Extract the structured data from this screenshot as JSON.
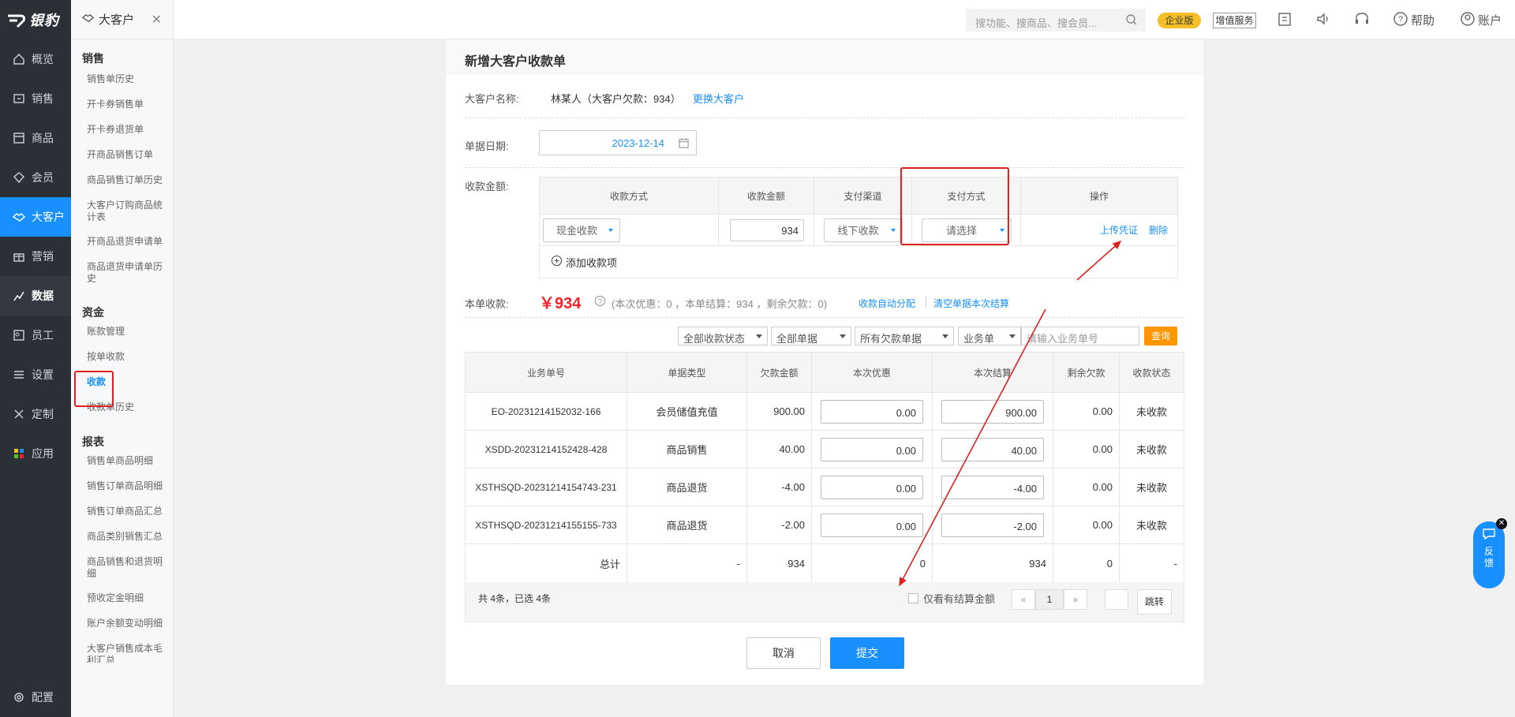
{
  "brand": {
    "name": "银豹"
  },
  "nav": {
    "items": [
      {
        "label": "概览",
        "icon": "home-icon"
      },
      {
        "label": "销售",
        "icon": "sales-icon"
      },
      {
        "label": "商品",
        "icon": "goods-icon"
      },
      {
        "label": "会员",
        "icon": "member-icon"
      },
      {
        "label": "大客户",
        "icon": "handshake-icon"
      },
      {
        "label": "营销",
        "icon": "marketing-icon"
      },
      {
        "label": "数据",
        "icon": "chart-icon"
      },
      {
        "label": "员工",
        "icon": "staff-icon"
      },
      {
        "label": "设置",
        "icon": "settings-icon"
      },
      {
        "label": "定制",
        "icon": "custom-icon"
      },
      {
        "label": "应用",
        "icon": "apps-icon"
      }
    ],
    "bottom": "配置"
  },
  "submenu": {
    "title": "大客户",
    "groups": [
      {
        "title": "销售",
        "links": [
          "销售单历史",
          "开卡券销售单",
          "开卡券退货单",
          "开商品销售订单",
          "商品销售订单历史",
          "大客户订购商品统计表",
          "开商品退货申请单",
          "商品退货申请单历史"
        ]
      },
      {
        "title": "资金",
        "links": [
          "账款管理",
          "按单收款",
          "收款",
          "收款单历史"
        ]
      },
      {
        "title": "报表",
        "links": [
          "销售单商品明细",
          "销售订单商品明细",
          "销售订单商品汇总",
          "商品类别销售汇总",
          "商品销售和退货明细",
          "预收定金明细",
          "账户余额变动明细",
          "大客户销售成本毛利汇总"
        ]
      }
    ]
  },
  "topbar": {
    "search_placeholder": "搜功能、搜商品、搜会员...",
    "enterprise": "企业版",
    "value_added": "增值服务",
    "help": "帮助",
    "account": "账户"
  },
  "form": {
    "title": "新增大客户收款单",
    "customer_label": "大客户名称:",
    "customer_value": "林某人（大客户欠款：934）",
    "change_customer": "更换大客户",
    "date_label": "单据日期:",
    "date_value": "2023-12-14",
    "amount_label": "收款金额:",
    "pay_headers": [
      "收款方式",
      "收款金额",
      "支付渠道",
      "支付方式",
      "操作"
    ],
    "pay_row": {
      "method": "现金收款",
      "amount": "934",
      "channel": "线下收款",
      "pay_type": "请选择",
      "upload": "上传凭证",
      "delete": "删除"
    },
    "add_item": "添加收款项",
    "total_label": "本单收款:",
    "total_amount": "￥934",
    "total_note": "(本次优惠：0 ，本单结算：934 ，剩余欠款：0)",
    "auto_alloc": "收款自动分配",
    "clear_alloc": "清空单据本次结算"
  },
  "filters": {
    "status": "全部收款状态",
    "docs": "全部单据",
    "debt": "所有欠款单据",
    "type": "业务单",
    "placeholder": "请输入业务单号",
    "query": "查询"
  },
  "table": {
    "headers": [
      "业务单号",
      "单据类型",
      "欠款金额",
      "本次优惠",
      "本次结算",
      "剩余欠款",
      "收款状态"
    ],
    "rows": [
      {
        "no": "EO-20231214152032-166",
        "type": "会员储值充值",
        "debt": "900.00",
        "discount": "0.00",
        "settle": "900.00",
        "remain": "0.00",
        "status": "未收款"
      },
      {
        "no": "XSDD-20231214152428-428",
        "type": "商品销售",
        "debt": "40.00",
        "discount": "0.00",
        "settle": "40.00",
        "remain": "0.00",
        "status": "未收款"
      },
      {
        "no": "XSTHSQD-20231214154743-231",
        "type": "商品退货",
        "debt": "-4.00",
        "discount": "0.00",
        "settle": "-4.00",
        "remain": "0.00",
        "status": "未收款"
      },
      {
        "no": "XSTHSQD-20231214155155-733",
        "type": "商品退货",
        "debt": "-2.00",
        "discount": "0.00",
        "settle": "-2.00",
        "remain": "0.00",
        "status": "未收款"
      }
    ],
    "total": {
      "label": "总计",
      "type": "-",
      "debt": "934",
      "discount": "0",
      "settle": "934",
      "remain": "0",
      "status": "-"
    },
    "summary": "共 4条，已选 4条",
    "only_settle": "仅看有结算金额",
    "prev": "«",
    "page": "1",
    "next": "»",
    "jump": "跳转"
  },
  "buttons": {
    "cancel": "取消",
    "submit": "提交"
  },
  "feedback": {
    "label": "反馈"
  },
  "colors": {
    "primary": "#1890ff",
    "nav_bg": "#2b2f36",
    "accent_red": "#f5222d",
    "highlight_red": "#e02020",
    "query_orange": "#ff9500"
  }
}
